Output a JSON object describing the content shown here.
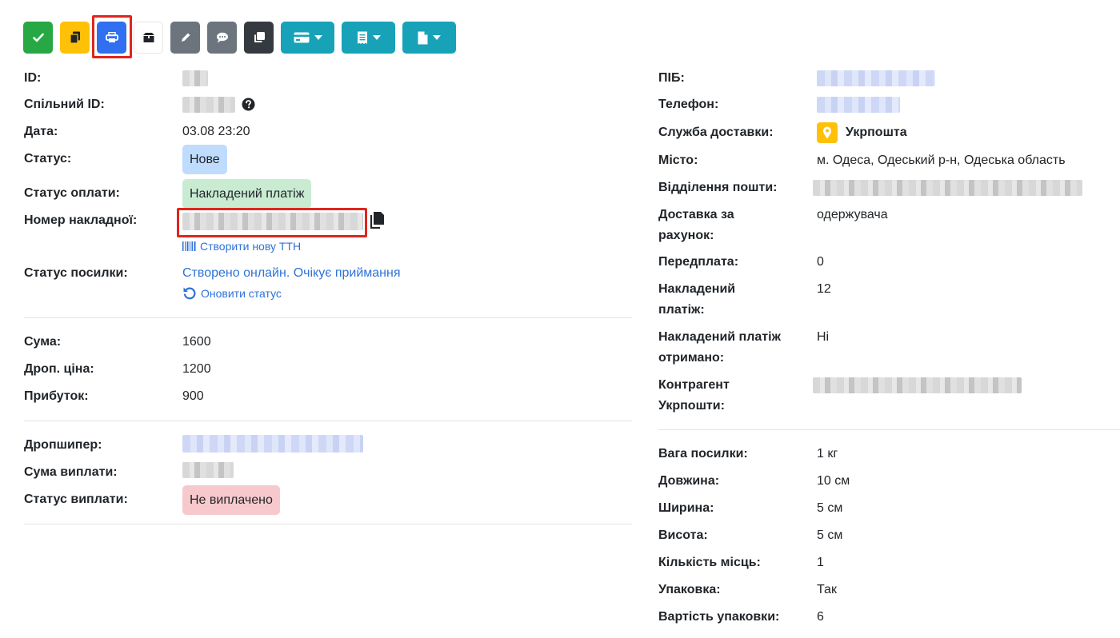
{
  "toolbar": {
    "buttons": [
      {
        "name": "confirm-button",
        "icon": "check-icon",
        "color": "#28a745"
      },
      {
        "name": "copy-button",
        "icon": "copy-icon",
        "color": "#ffc107"
      },
      {
        "name": "print-button",
        "icon": "print-icon",
        "color": "#2f6ff0"
      },
      {
        "name": "package-button",
        "icon": "box-icon",
        "color": "#ffffff"
      },
      {
        "name": "edit-button",
        "icon": "pencil-icon",
        "color": "#6c757d"
      },
      {
        "name": "comment-button",
        "icon": "comment-icon",
        "color": "#6c757d"
      },
      {
        "name": "duplicate-button",
        "icon": "clone-icon",
        "color": "#343a40"
      },
      {
        "name": "payment-dropdown-button",
        "icon": "credit-card-icon",
        "color": "#17a2b8"
      },
      {
        "name": "receipt-dropdown-button",
        "icon": "receipt-icon",
        "color": "#17a2b8"
      },
      {
        "name": "document-dropdown-button",
        "icon": "file-icon",
        "color": "#17a2b8"
      }
    ]
  },
  "left": {
    "id_label": "ID:",
    "shared_id_label": "Спільний ID:",
    "date_label": "Дата:",
    "date_value": "03.08 23:20",
    "status_label": "Статус:",
    "status_value": "Нове",
    "payment_status_label": "Статус оплати:",
    "payment_status_value": "Накладений платіж",
    "invoice_label": "Номер накладної:",
    "create_ttn_link": "Створити нову ТТН",
    "parcel_status_label": "Статус посилки:",
    "parcel_status_value": "Створено онлайн. Очікує приймання",
    "refresh_status_link": "Оновити статус",
    "sum_label": "Сума:",
    "sum_value": "1600",
    "drop_price_label": "Дроп. ціна:",
    "drop_price_value": "1200",
    "profit_label": "Прибуток:",
    "profit_value": "900",
    "dropshipper_label": "Дропшипер:",
    "payout_sum_label": "Сума виплати:",
    "payout_status_label": "Статус виплати:",
    "payout_status_value": "Не виплачено"
  },
  "right": {
    "name_label": "ПІБ:",
    "phone_label": "Телефон:",
    "delivery_service_label": "Служба доставки:",
    "delivery_service_value": "Укрпошта",
    "city_label": "Місто:",
    "city_value": "м. Одеса, Одеський р-н, Одеська область",
    "post_office_label": "Відділення пошти:",
    "delivery_paid_label_1": "Доставка за",
    "delivery_paid_label_2": "рахунок:",
    "delivery_paid_value": "одержувача",
    "prepayment_label": "Передплата:",
    "prepayment_value": "0",
    "cod_label_1": "Накладений",
    "cod_label_2": "платіж:",
    "cod_value": "12",
    "cod_received_label_1": "Накладений платіж",
    "cod_received_label_2": "отримано:",
    "cod_received_value": "Ні",
    "counterparty_label_1": "Контрагент",
    "counterparty_label_2": "Укрпошти:",
    "weight_label": "Вага посилки:",
    "weight_value": "1 кг",
    "length_label": "Довжина:",
    "length_value": "10 см",
    "width_label": "Ширина:",
    "width_value": "5 см",
    "height_label": "Висота:",
    "height_value": "5 см",
    "places_label": "Кількість місць:",
    "places_value": "1",
    "packaging_label": "Упаковка:",
    "packaging_value": "Так",
    "packaging_cost_label": "Вартість упаковки:",
    "packaging_cost_value": "6"
  }
}
